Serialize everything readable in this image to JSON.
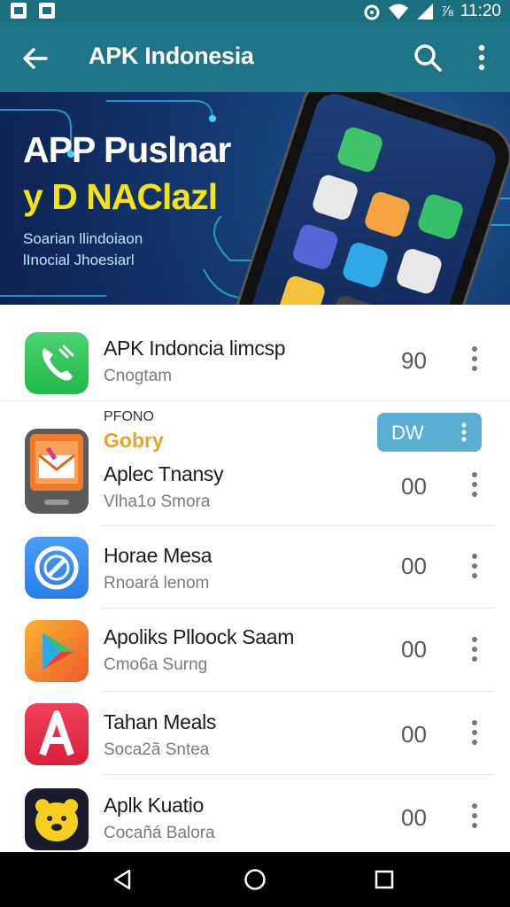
{
  "status": {
    "time": "11:20",
    "battery": "⅞"
  },
  "appbar": {
    "title": "APK Indonesia"
  },
  "banner": {
    "headline": "APP Puslnar",
    "headline2": "y D NAClazl",
    "sub1": "Soarian llindoiaon",
    "sub2": "lInocial Jhoesiarl"
  },
  "colors": {
    "appbar": "#1d7587",
    "statusbar": "#1b6f7f",
    "accent_yellow": "#f5e21a",
    "download": "#5aaed0"
  },
  "apps": [
    {
      "name": "APK Indoncia limcsp",
      "sub": "Cnogtam",
      "count": "90",
      "icon": "phone-app-icon"
    },
    {
      "category": "PFONO",
      "tag": "Gobry",
      "name": "Aplec Tnansy",
      "sub": "Vlha1o Smora",
      "count": "00",
      "action": "DW",
      "icon": "mail-app-icon"
    },
    {
      "name": "Horae Mesa",
      "sub": "Rnoará lenom",
      "count": "00",
      "icon": "compass-app-icon"
    },
    {
      "name": "Apoliks Plloock Saam",
      "sub": "Cmo6a Surng",
      "count": "00",
      "icon": "play-app-icon"
    },
    {
      "name": "Tahan Meals",
      "sub": "Soca2ã Sntea",
      "count": "00",
      "icon": "letter-a-app-icon"
    },
    {
      "name": "Aplk Kuatio",
      "sub": "Cocañá Balora",
      "count": "00",
      "icon": "bear-app-icon"
    }
  ]
}
